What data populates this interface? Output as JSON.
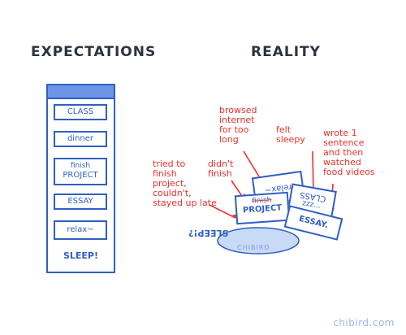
{
  "headings": {
    "expectations": "EXPECTATIONS",
    "reality": "REALITY"
  },
  "planner": {
    "items": [
      {
        "label": "CLASS"
      },
      {
        "label": "dinner"
      },
      {
        "line1": "finish",
        "line2": "PROJECT"
      },
      {
        "label": "ESSAY"
      },
      {
        "label": "relax~"
      }
    ],
    "sleep": "SLEEP!"
  },
  "reality": {
    "notes": {
      "browsed": "browsed\ninternet\nfor too\nlong",
      "felt": "felt\nsleepy",
      "wrote": "wrote 1\nsentence\nand then\nwatched\nfood videos",
      "tried": "tried to\nfinish\nproject,\ncouldn't,\nstayed up late",
      "didnt": "didn't\nfinish"
    },
    "cards": {
      "relax": "relax~",
      "finish": "finish",
      "project": "PROJECT",
      "class": "CLASS",
      "essay": "ESSAY.",
      "zzz": "zzz...",
      "sleep": "SLEEP!?"
    },
    "blob_text": "CHIBIRD"
  },
  "watermark": "chibird.com"
}
